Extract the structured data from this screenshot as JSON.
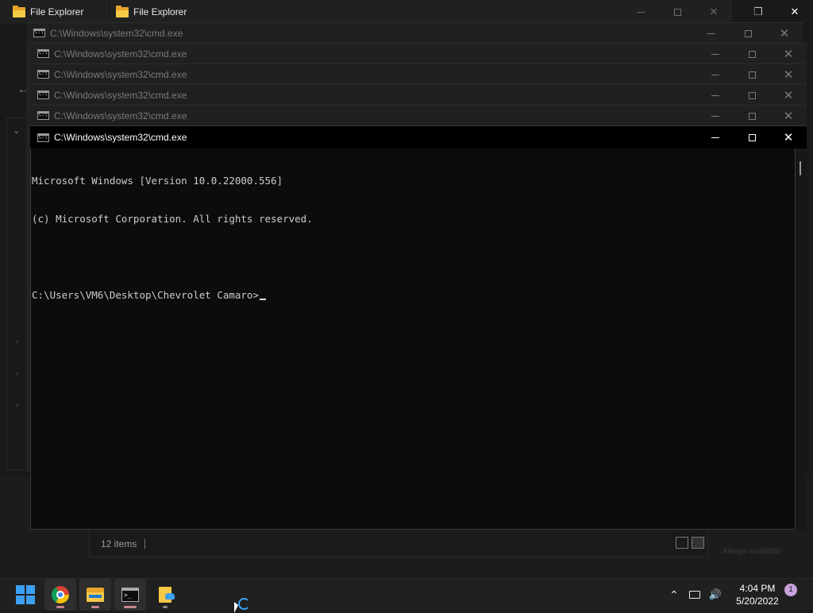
{
  "file_explorer_windows": [
    {
      "title": "File Explorer"
    },
    {
      "title": "File Explorer"
    }
  ],
  "file_explorer": {
    "status_item_count": "12 items",
    "faint_watermark": "Always available"
  },
  "cmd_windows": [
    {
      "title": "C:\\Windows\\system32\\cmd.exe"
    },
    {
      "title": "C:\\Windows\\system32\\cmd.exe"
    },
    {
      "title": "C:\\Windows\\system32\\cmd.exe"
    },
    {
      "title": "C:\\Windows\\system32\\cmd.exe"
    },
    {
      "title": "C:\\Windows\\system32\\cmd.exe"
    },
    {
      "title": "C:\\Windows\\system32\\cmd.exe"
    }
  ],
  "console": {
    "lines": [
      "Microsoft Windows [Version 10.0.22000.556]",
      "(c) Microsoft Corporation. All rights reserved.",
      "",
      "C:\\Users\\VM6\\Desktop\\Chevrolet Camaro>"
    ]
  },
  "window_controls": {
    "minimize": "—",
    "maximize": "☐",
    "close": "✕",
    "restore": "❐"
  },
  "taskbar": {
    "apps": [
      {
        "name": "Start",
        "icon": "windows-logo-icon"
      },
      {
        "name": "Google Chrome",
        "icon": "chrome-icon"
      },
      {
        "name": "File Explorer",
        "icon": "folder-icon"
      },
      {
        "name": "Command Prompt",
        "icon": "cmd-icon"
      },
      {
        "name": "Archive",
        "icon": "zip-folder-icon"
      }
    ],
    "time": "4:04 PM",
    "date": "5/20/2022",
    "notification_count": "1",
    "tray_icons": [
      "chevron-up-icon",
      "network-icon",
      "volume-icon"
    ]
  },
  "colors": {
    "accent": "#3ba0f2",
    "console_bg": "#0c0c0c",
    "console_text": "#cccccc",
    "taskbar_bg": "#202020"
  }
}
